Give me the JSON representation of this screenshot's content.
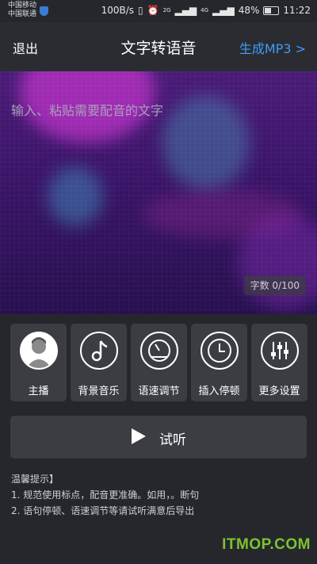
{
  "status_bar": {
    "carrier1": "中国移动",
    "carrier2": "中国联通",
    "net_speed": "100B/s",
    "signal_a": "2G",
    "signal_b": "4G",
    "battery": "48%",
    "time": "11:22"
  },
  "header": {
    "exit_label": "退出",
    "title": "文字转语音",
    "generate_label": "生成MP3 >"
  },
  "editor": {
    "placeholder": "输入、粘贴需要配音的文字",
    "value": "",
    "counter": "字数 0/100"
  },
  "tools": [
    {
      "label": "主播",
      "icon": "anchor-avatar-icon"
    },
    {
      "label": "背景音乐",
      "icon": "music-note-icon"
    },
    {
      "label": "语速调节",
      "icon": "speed-gauge-icon"
    },
    {
      "label": "插入停顿",
      "icon": "clock-icon"
    },
    {
      "label": "更多设置",
      "icon": "sliders-icon"
    }
  ],
  "play_button": {
    "label": "试听",
    "icon": "play-icon"
  },
  "tips": {
    "title": "温馨提示】",
    "line1": "1. 规范使用标点，配音更准确。如用，。断句",
    "line2": "2. 语句停顿、语速调节等请试听满意后导出"
  },
  "watermark": "ITMOP.COM",
  "colors": {
    "accent": "#3f9df5",
    "background": "#25272c",
    "panel": "#3b3d43",
    "watermark": "#7dc232"
  }
}
